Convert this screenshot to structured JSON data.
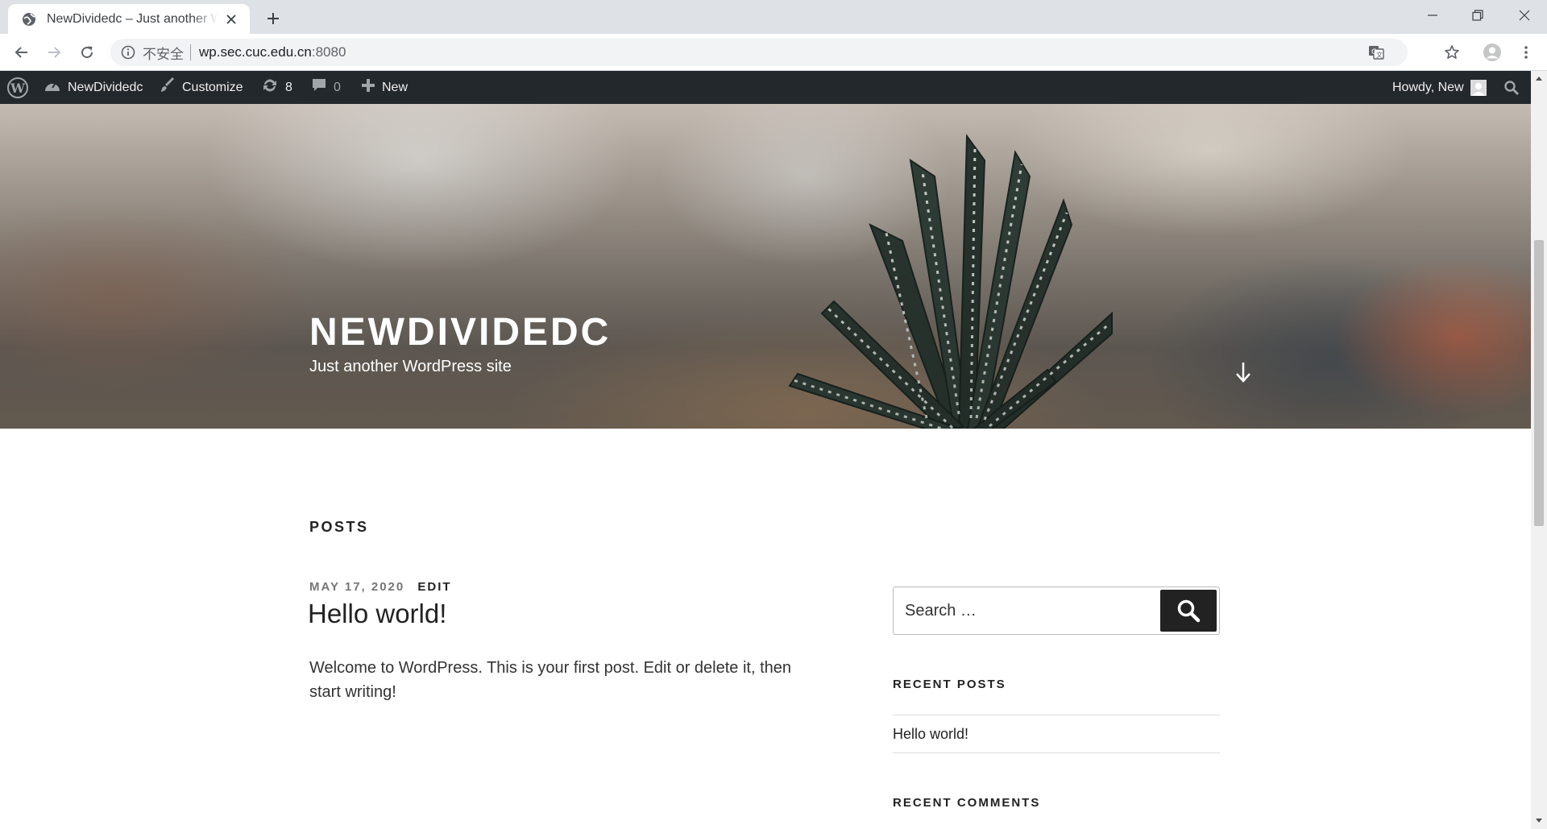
{
  "browser": {
    "tab_title": "NewDividedc – Just another WordPress site",
    "security_label": "不安全",
    "url_host": "wp.sec.cuc.edu.cn",
    "url_port": ":8080"
  },
  "adminbar": {
    "site_name": "NewDividedc",
    "customize_label": "Customize",
    "updates_count": "8",
    "comments_count": "0",
    "new_label": "New",
    "howdy": "Howdy, New"
  },
  "hero": {
    "site_title": "NEWDIVIDEDC",
    "tagline": "Just another WordPress site"
  },
  "main": {
    "posts_heading": "POSTS",
    "post": {
      "date": "MAY 17, 2020",
      "edit_label": "EDIT",
      "title": "Hello world!",
      "excerpt": "Welcome to WordPress. This is your first post. Edit or delete it, then start writing!"
    }
  },
  "sidebar": {
    "search_placeholder": "Search …",
    "recent_posts_title": "RECENT POSTS",
    "recent_posts": [
      "Hello world!"
    ],
    "recent_comments_title": "RECENT COMMENTS"
  },
  "colors": {
    "adminbar_bg": "#23282d",
    "tabstrip_bg": "#dee1e6",
    "search_button": "#222222"
  },
  "icons": [
    "globe-icon",
    "close-icon",
    "plus-icon",
    "minimize-icon",
    "restore-icon",
    "back-icon",
    "forward-icon",
    "reload-icon",
    "info-icon",
    "translate-icon",
    "star-icon",
    "profile-icon",
    "menu-icon",
    "wordpress-logo-icon",
    "dashboard-icon",
    "brush-icon",
    "updates-icon",
    "comment-icon",
    "avatar-icon",
    "search-icon",
    "arrow-down-icon"
  ]
}
